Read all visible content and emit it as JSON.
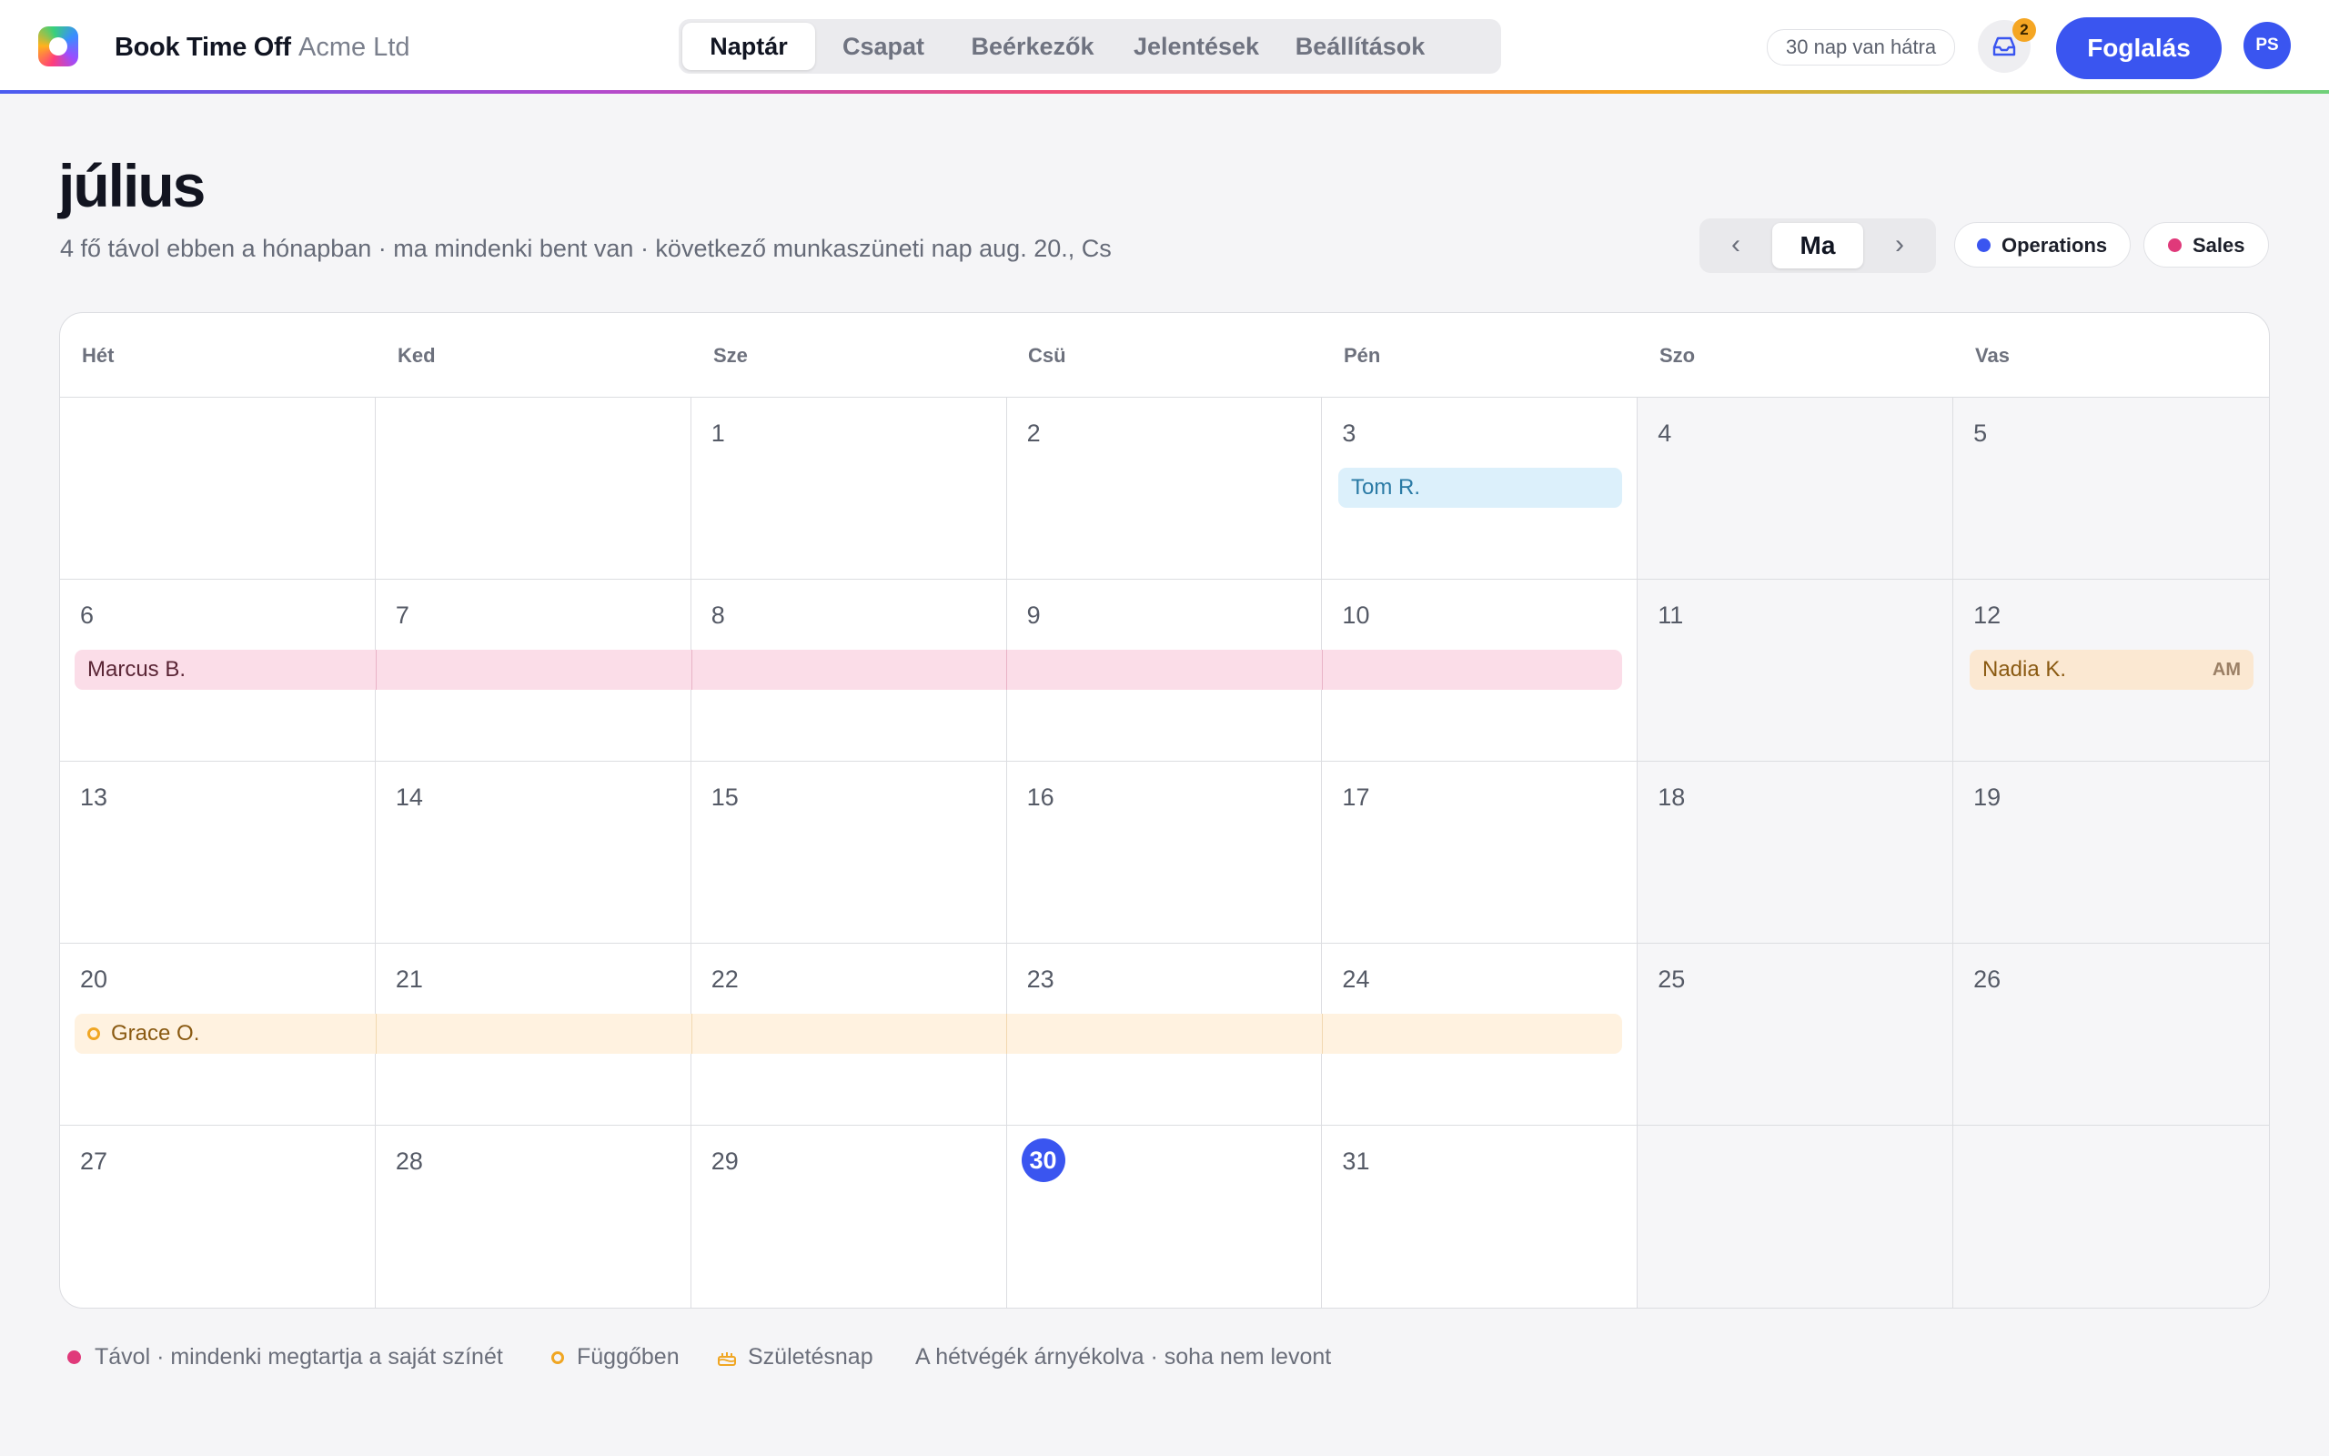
{
  "app": {
    "name": "Book Time Off",
    "company": "Acme Ltd"
  },
  "nav": {
    "tabs": [
      "Naptár",
      "Csapat",
      "Beérkezők",
      "Jelentések",
      "Beállítások"
    ],
    "active": "Naptár"
  },
  "header": {
    "days_left": "30 nap van hátra",
    "inbox_count": "2",
    "book_label": "Foglalás",
    "avatar_initials": "PS"
  },
  "page": {
    "month": "július",
    "subtitle": "4 fő távol ebben a hónapban · ma mindenki bent van · következő munkaszüneti nap aug. 20., Cs"
  },
  "pager": {
    "prev": "‹",
    "today": "Ma",
    "next": "›"
  },
  "filters": [
    {
      "label": "Operations",
      "color": "#3a55f0"
    },
    {
      "label": "Sales",
      "color": "#e0397a"
    }
  ],
  "calendar": {
    "weekdays": [
      "Hét",
      "Ked",
      "Sze",
      "Csü",
      "Pén",
      "Szo",
      "Vas"
    ],
    "weeks": [
      [
        "",
        "",
        "1",
        "2",
        "3",
        "4",
        "5"
      ],
      [
        "6",
        "7",
        "8",
        "9",
        "10",
        "11",
        "12"
      ],
      [
        "13",
        "14",
        "15",
        "16",
        "17",
        "18",
        "19"
      ],
      [
        "20",
        "21",
        "22",
        "23",
        "24",
        "25",
        "26"
      ],
      [
        "27",
        "28",
        "29",
        "30",
        "31",
        "",
        ""
      ]
    ],
    "today": "30",
    "events": {
      "tom": {
        "name": "Tom R."
      },
      "marcus": {
        "name": "Marcus B."
      },
      "nadia": {
        "name": "Nadia K.",
        "tag": "AM"
      },
      "grace": {
        "name": "Grace O."
      }
    }
  },
  "legend": {
    "away": "Távol · mindenki megtartja a saját színét",
    "pending": "Függőben",
    "birthday": "Születésnap",
    "note": "A hétvégék árnyékolva · soha nem levont"
  }
}
